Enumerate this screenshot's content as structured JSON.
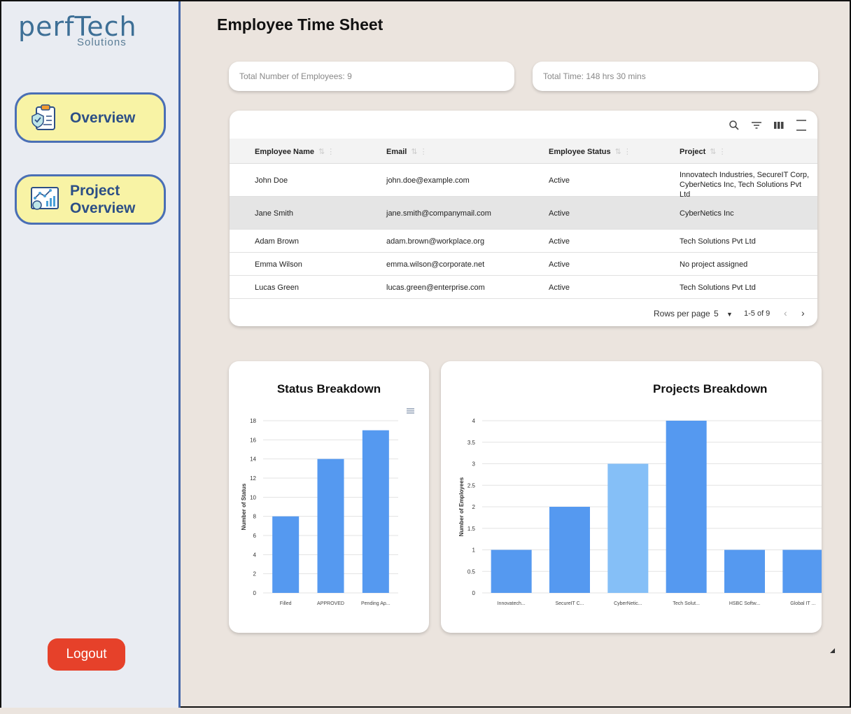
{
  "sidebar": {
    "logo_main": "perfTech",
    "logo_sub": "Solutions",
    "nav": [
      {
        "label": "Overview",
        "icon": "clipboard-check-icon"
      },
      {
        "label_line1": "Project",
        "label_line2": "Overview",
        "icon": "presentation-chart-icon"
      }
    ],
    "logout_label": "Logout"
  },
  "page": {
    "title": "Employee Time Sheet"
  },
  "stats": {
    "employees": "Total Number of Employees: 9",
    "time": "Total Time: 148 hrs 30 mins"
  },
  "table": {
    "toolbar_icons": [
      "search-icon",
      "filter-icon",
      "columns-icon",
      "density-icon"
    ],
    "columns": [
      "Employee Name",
      "Email",
      "Employee Status",
      "Project"
    ],
    "rows": [
      {
        "name": "John Doe",
        "email": "john.doe@example.com",
        "status": "Active",
        "project": "Innovatech Industries, SecureIT Corp, CyberNetics Inc, Tech Solutions Pvt Ltd"
      },
      {
        "name": "Jane Smith",
        "email": "jane.smith@companymail.com",
        "status": "Active",
        "project": "CyberNetics Inc"
      },
      {
        "name": "Adam Brown",
        "email": "adam.brown@workplace.org",
        "status": "Active",
        "project": "Tech Solutions Pvt Ltd"
      },
      {
        "name": "Emma Wilson",
        "email": "emma.wilson@corporate.net",
        "status": "Active",
        "project": "No project assigned"
      },
      {
        "name": "Lucas Green",
        "email": "lucas.green@enterprise.com",
        "status": "Active",
        "project": "Tech Solutions Pvt Ltd"
      }
    ],
    "highlighted_row": 1,
    "footer": {
      "rows_per_page_label": "Rows per page",
      "rows_per_page": "5",
      "range": "1-5 of 9"
    }
  },
  "chart_data": [
    {
      "type": "bar",
      "title": "Status Breakdown",
      "ylabel": "Number of Status",
      "categories": [
        "Filled",
        "APPROVED",
        "Pending Ap..."
      ],
      "values": [
        8,
        14,
        17
      ],
      "ylim": [
        0,
        18
      ],
      "yticks": [
        0,
        2,
        4,
        6,
        8,
        10,
        12,
        14,
        16,
        18
      ],
      "color": "#5599f0",
      "grid": true
    },
    {
      "type": "bar",
      "title": "Projects Breakdown",
      "ylabel": "Number of Employees",
      "categories": [
        "Innovatech...",
        "SecureIT C...",
        "CyberNetic...",
        "Tech Solut...",
        "HSBC Softw...",
        "Global IT ..."
      ],
      "values": [
        1,
        2,
        3,
        4,
        1,
        1
      ],
      "ylim": [
        0,
        4
      ],
      "yticks": [
        0,
        0.5,
        1,
        1.5,
        2,
        2.5,
        3,
        3.5,
        4
      ],
      "color": "#5599f0",
      "highlight_color": "#85bff7",
      "highlight_index": 2,
      "grid": true
    }
  ]
}
